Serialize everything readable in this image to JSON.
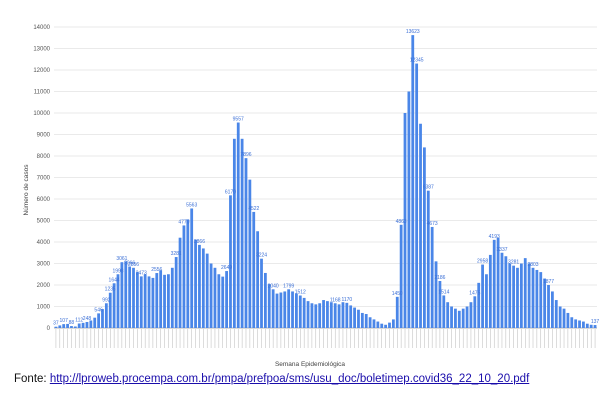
{
  "chart_data": {
    "type": "bar",
    "title": "",
    "xlabel": "Semana Epidemiológica",
    "ylabel": "Número de casos",
    "ylim": [
      0,
      14000
    ],
    "yticks": [
      0,
      1000,
      2000,
      3000,
      4000,
      5000,
      6000,
      7000,
      8000,
      9000,
      10000,
      11000,
      12000,
      13000,
      14000
    ],
    "grid": "horizontal",
    "legend": "none",
    "series_color": "#4a86e8",
    "values": [
      60,
      120,
      180,
      190,
      90,
      70,
      210,
      240,
      280,
      350,
      480,
      680,
      880,
      1150,
      1640,
      2080,
      2500,
      3060,
      3100,
      2860,
      2800,
      2600,
      2400,
      2500,
      2400,
      2330,
      2556,
      2680,
      2473,
      2500,
      2800,
      3300,
      4200,
      4770,
      5050,
      5560,
      4100,
      3866,
      3700,
      3460,
      3000,
      2800,
      2500,
      2390,
      2649,
      6170,
      8800,
      9557,
      8800,
      7900,
      6900,
      5400,
      4500,
      3224,
      2560,
      2040,
      1800,
      1600,
      1650,
      1700,
      1800,
      1700,
      1600,
      1512,
      1400,
      1250,
      1150,
      1100,
      1150,
      1300,
      1250,
      1200,
      1150,
      1100,
      1200,
      1170,
      1050,
      950,
      850,
      700,
      650,
      500,
      400,
      300,
      200,
      150,
      250,
      400,
      1450,
      4800,
      10000,
      11000,
      13623,
      12300,
      9500,
      8400,
      6387,
      4700,
      3100,
      2186,
      1514,
      1200,
      1000,
      900,
      800,
      900,
      1000,
      1200,
      1475,
      2100,
      2950,
      2500,
      3400,
      4100,
      4193,
      3500,
      3337,
      3000,
      2900,
      2800,
      3000,
      3250,
      3000,
      2800,
      2700,
      2600,
      2300,
      2000,
      1700,
      1300,
      1000,
      900,
      700,
      500,
      400,
      350,
      300,
      200,
      150,
      137
    ],
    "data_labels": [
      {
        "index": 0,
        "text": "37"
      },
      {
        "index": 2,
        "text": "107"
      },
      {
        "index": 4,
        "text": "88"
      },
      {
        "index": 6,
        "text": "112"
      },
      {
        "index": 8,
        "text": "248"
      },
      {
        "index": 11,
        "text": "546"
      },
      {
        "index": 13,
        "text": "992"
      },
      {
        "index": 14,
        "text": "1235"
      },
      {
        "index": 15,
        "text": "1644"
      },
      {
        "index": 16,
        "text": "1998"
      },
      {
        "index": 17,
        "text": "3061"
      },
      {
        "index": 19,
        "text": "3066"
      },
      {
        "index": 20,
        "text": "2856"
      },
      {
        "index": 22,
        "text": "2473"
      },
      {
        "index": 26,
        "text": "2556"
      },
      {
        "index": 31,
        "text": "3281"
      },
      {
        "index": 33,
        "text": "4770"
      },
      {
        "index": 35,
        "text": "5563"
      },
      {
        "index": 37,
        "text": "3866"
      },
      {
        "index": 44,
        "text": "2649"
      },
      {
        "index": 45,
        "text": "6170"
      },
      {
        "index": 47,
        "text": "9557"
      },
      {
        "index": 49,
        "text": "7896"
      },
      {
        "index": 51,
        "text": "4522"
      },
      {
        "index": 53,
        "text": "3224"
      },
      {
        "index": 56,
        "text": "2040"
      },
      {
        "index": 60,
        "text": "1799"
      },
      {
        "index": 63,
        "text": "1512"
      },
      {
        "index": 72,
        "text": "1168"
      },
      {
        "index": 75,
        "text": "1170"
      },
      {
        "index": 88,
        "text": "1450"
      },
      {
        "index": 89,
        "text": "4863"
      },
      {
        "index": 92,
        "text": "13623"
      },
      {
        "index": 93,
        "text": "12345"
      },
      {
        "index": 96,
        "text": "6387"
      },
      {
        "index": 97,
        "text": "4673"
      },
      {
        "index": 99,
        "text": "2186"
      },
      {
        "index": 100,
        "text": "1514"
      },
      {
        "index": 108,
        "text": "1475"
      },
      {
        "index": 110,
        "text": "2958"
      },
      {
        "index": 113,
        "text": "4193"
      },
      {
        "index": 115,
        "text": "3337"
      },
      {
        "index": 118,
        "text": "3281"
      },
      {
        "index": 123,
        "text": "2803"
      },
      {
        "index": 127,
        "text": "1877"
      },
      {
        "index": 139,
        "text": "137"
      }
    ]
  },
  "source": {
    "prefix": "Fonte: ",
    "url": "http://lproweb.procempa.com.br/pmpa/prefpoa/sms/usu_doc/boletimep.covid36_22_10_20.pdf"
  }
}
